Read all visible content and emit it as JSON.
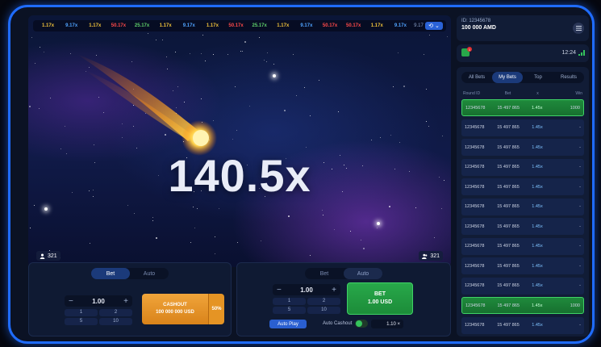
{
  "history": {
    "multipliers": [
      {
        "value": "1.17x",
        "color": "#f0c23a"
      },
      {
        "value": "9.17x",
        "color": "#4fa3ff"
      },
      {
        "value": "1.17x",
        "color": "#f0c23a"
      },
      {
        "value": "50.17x",
        "color": "#ff4a4a"
      },
      {
        "value": "25.17x",
        "color": "#5fd06a"
      },
      {
        "value": "1.17x",
        "color": "#f0c23a"
      },
      {
        "value": "9.17x",
        "color": "#4fa3ff"
      },
      {
        "value": "1.17x",
        "color": "#f0c23a"
      },
      {
        "value": "50.17x",
        "color": "#ff4a4a"
      },
      {
        "value": "25.17x",
        "color": "#5fd06a"
      },
      {
        "value": "1.17x",
        "color": "#f0c23a"
      },
      {
        "value": "9.17x",
        "color": "#4fa3ff"
      },
      {
        "value": "50.17x",
        "color": "#ff4a4a"
      },
      {
        "value": "50.17x",
        "color": "#ff4a4a"
      },
      {
        "value": "1.17x",
        "color": "#f0c23a"
      },
      {
        "value": "9.17x",
        "color": "#4fa3ff"
      }
    ],
    "trailing": "9.17",
    "history_icon": "history-icon"
  },
  "game": {
    "multiplier": "140.5x",
    "players_left": "321",
    "players_right": "321"
  },
  "bet_left": {
    "tab_bet": "Bet",
    "tab_auto": "Auto",
    "minus": "−",
    "plus": "+",
    "amount": "1.00",
    "quick": [
      "1",
      "2",
      "5",
      "10"
    ],
    "cashout_label": "CASHOUT",
    "cashout_amount": "100 000 000 USD",
    "cashout_pct": "50%"
  },
  "bet_right": {
    "tab_bet": "Bet",
    "tab_auto": "Auto",
    "minus": "−",
    "plus": "+",
    "amount": "1.00",
    "quick": [
      "1",
      "2",
      "5",
      "10"
    ],
    "bet_label": "BET",
    "bet_amount": "1.00 USD",
    "autoplay_label": "Auto Play",
    "auto_cashout_label": "Auto Cashout",
    "auto_cashout_value": "1.10 ×"
  },
  "account": {
    "id": "ID: 12345678",
    "balance": "100 000 AMD",
    "notifications": "1",
    "time": "12:24"
  },
  "bets": {
    "tabs": [
      "All Bets",
      "My Bets",
      "Top",
      "Results"
    ],
    "active_tab": 1,
    "headers": [
      "Round ID",
      "Bet",
      "x",
      "Win"
    ],
    "rows": [
      {
        "round": "12345678",
        "bet": "15 497 865",
        "coef": "1.45x",
        "win": "1000",
        "won": true
      },
      {
        "round": "12345678",
        "bet": "15 497 865",
        "coef": "1.45x",
        "win": "-",
        "won": false
      },
      {
        "round": "12345678",
        "bet": "15 497 865",
        "coef": "1.45x",
        "win": "-",
        "won": false
      },
      {
        "round": "12345678",
        "bet": "15 497 865",
        "coef": "1.45x",
        "win": "-",
        "won": false
      },
      {
        "round": "12345678",
        "bet": "15 497 865",
        "coef": "1.45x",
        "win": "-",
        "won": false
      },
      {
        "round": "12345678",
        "bet": "15 497 865",
        "coef": "1.45x",
        "win": "-",
        "won": false
      },
      {
        "round": "12345678",
        "bet": "15 497 865",
        "coef": "1.45x",
        "win": "-",
        "won": false
      },
      {
        "round": "12345678",
        "bet": "15 497 865",
        "coef": "1.45x",
        "win": "-",
        "won": false
      },
      {
        "round": "12345678",
        "bet": "15 497 865",
        "coef": "1.45x",
        "win": "-",
        "won": false
      },
      {
        "round": "12345678",
        "bet": "15 497 865",
        "coef": "1.45x",
        "win": "-",
        "won": false
      },
      {
        "round": "12345678",
        "bet": "15 497 865",
        "coef": "1.45x",
        "win": "1000",
        "won": true
      },
      {
        "round": "12345678",
        "bet": "15 497 865",
        "coef": "1.45x",
        "win": "-",
        "won": false
      }
    ]
  }
}
